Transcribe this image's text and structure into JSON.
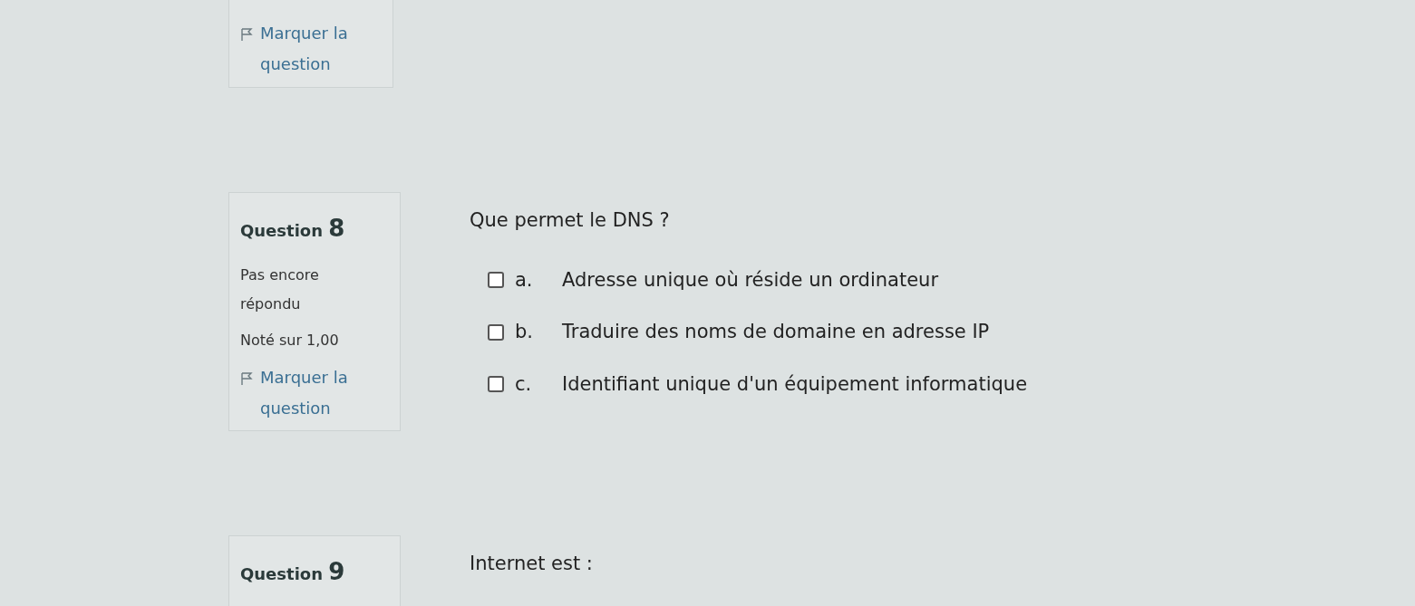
{
  "previous_question": {
    "flag_link": "Marquer la question"
  },
  "questions": [
    {
      "label": "Question",
      "number": "8",
      "status": "Pas encore répondu",
      "grade": "Noté sur 1,00",
      "flag_link": "Marquer la question",
      "text": "Que permet le DNS ?",
      "options": [
        {
          "letter": "a.",
          "text": "Adresse unique où réside un ordinateur",
          "checked": false
        },
        {
          "letter": "b.",
          "text": "Traduire des noms de domaine en adresse IP",
          "checked": false
        },
        {
          "letter": "c.",
          "text": "Identifiant unique d'un équipement informatique",
          "checked": false
        }
      ]
    },
    {
      "label": "Question",
      "number": "9",
      "text": "Internet est :"
    }
  ]
}
